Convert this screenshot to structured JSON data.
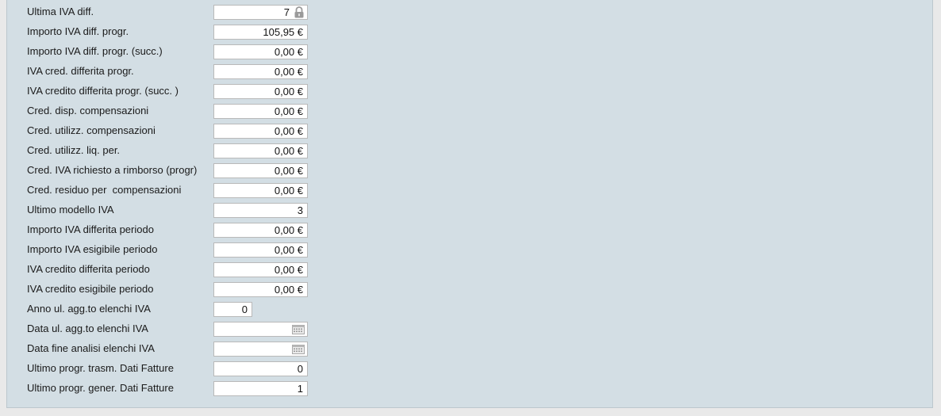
{
  "rows": [
    {
      "label": "Ultima IVA diff.",
      "value": "7",
      "icon": "lock-icon"
    },
    {
      "label": "Importo IVA diff. progr.",
      "value": "105,95 €"
    },
    {
      "label": "Importo IVA diff. progr. (succ.)",
      "value": "0,00 €"
    },
    {
      "label": "IVA cred. differita progr.",
      "value": "0,00 €"
    },
    {
      "label": "IVA credito differita progr. (succ. )",
      "value": "0,00 €"
    },
    {
      "label": "Cred. disp. compensazioni",
      "value": "0,00 €"
    },
    {
      "label": "Cred. utilizz. compensazioni",
      "value": "0,00 €"
    },
    {
      "label": "Cred. utilizz. liq. per.",
      "value": "0,00 €"
    },
    {
      "label": "Cred. IVA richiesto a rimborso (progr)",
      "value": "0,00 €"
    },
    {
      "label": "Cred. residuo per  compensazioni",
      "value": "0,00 €"
    },
    {
      "label": "Ultimo modello IVA",
      "value": "3"
    },
    {
      "label": "Importo IVA differita periodo",
      "value": "0,00 €"
    },
    {
      "label": "Importo IVA esigibile periodo",
      "value": "0,00 €"
    },
    {
      "label": "IVA credito differita periodo",
      "value": "0,00 €"
    },
    {
      "label": "IVA credito esigibile periodo",
      "value": "0,00 €"
    },
    {
      "label": "Anno ul. agg.to elenchi IVA",
      "value": "0"
    },
    {
      "label": "Data ul. agg.to elenchi IVA",
      "value": "",
      "icon": "calendar-icon"
    },
    {
      "label": "Data fine analisi elenchi IVA",
      "value": "",
      "icon": "calendar-icon"
    },
    {
      "label": "Ultimo progr. trasm. Dati Fatture",
      "value": "0"
    },
    {
      "label": "Ultimo progr. gener. Dati Fatture",
      "value": "1"
    }
  ]
}
